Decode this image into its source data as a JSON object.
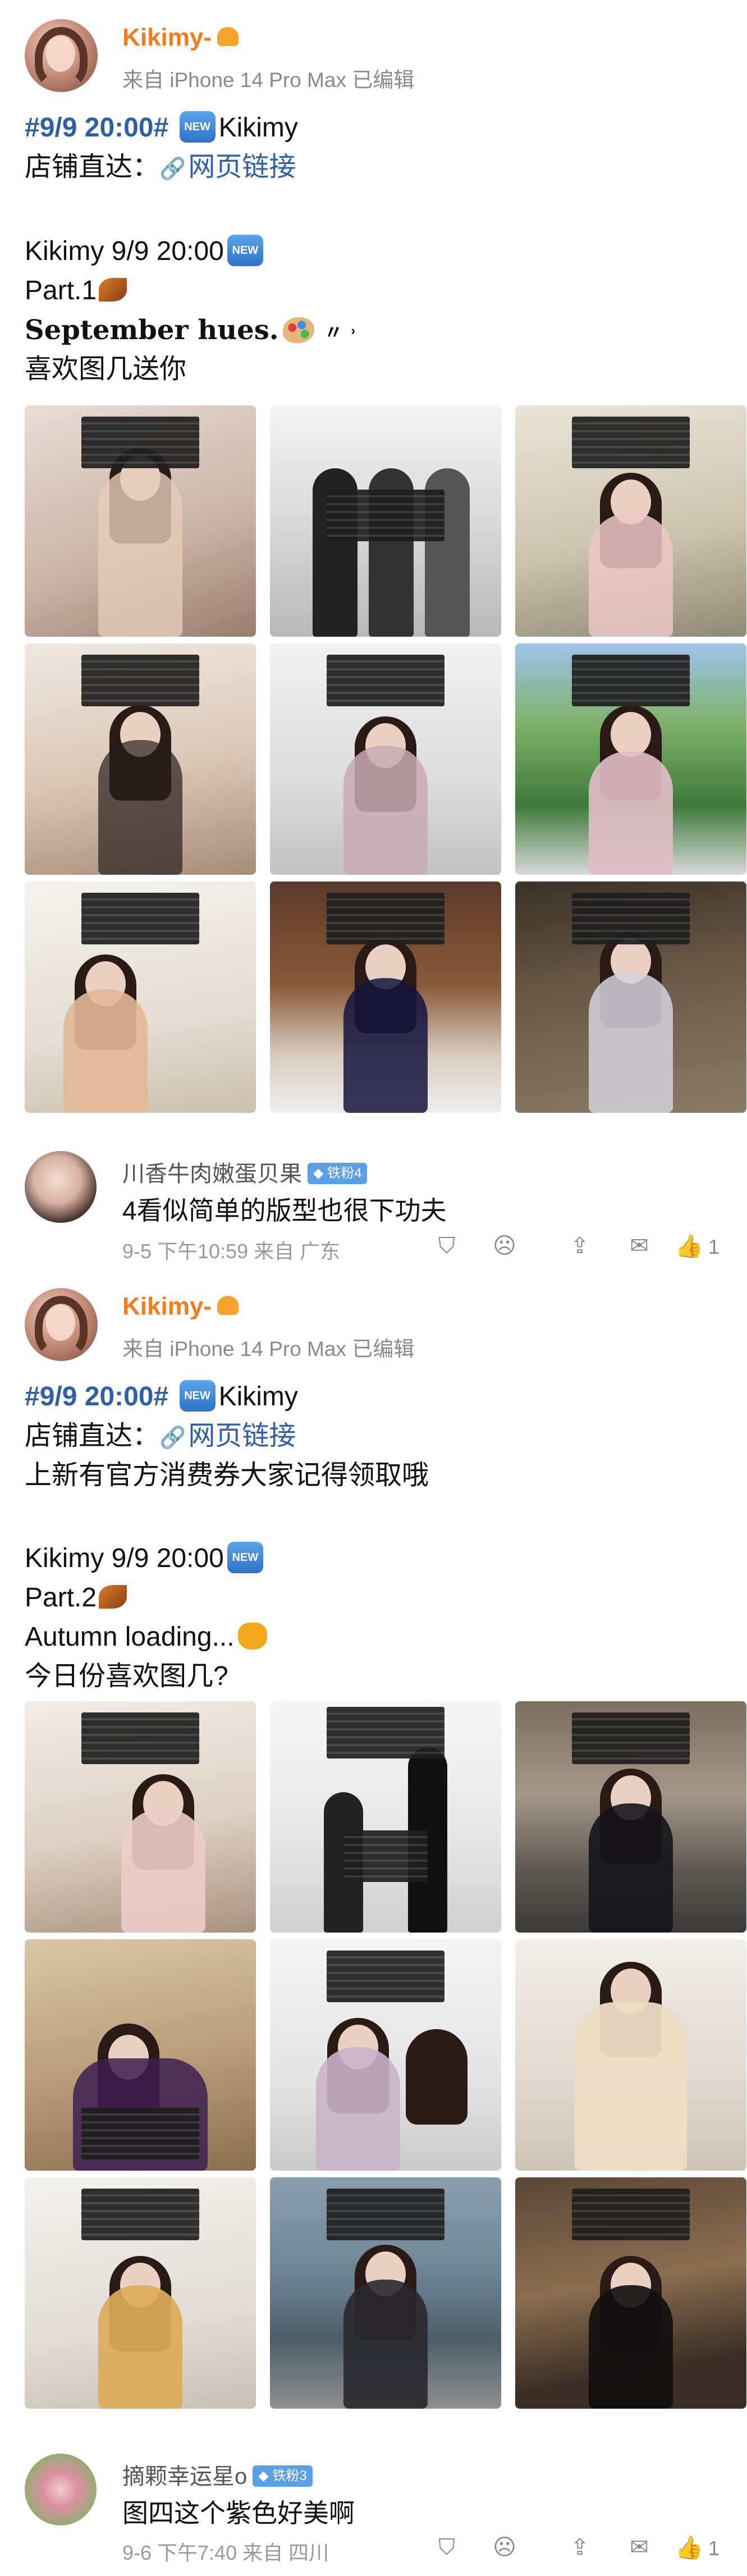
{
  "posts": [
    {
      "author": {
        "name": "Kikimy-",
        "subline": "来自 iPhone 14 Pro Max  已编辑"
      },
      "hashtag": "#9/9 20:00#",
      "hashtag_after": "Kikimy",
      "shop_label": "店铺直达：",
      "shop_link": "网页链接",
      "extra_line": "",
      "title": "Kikimy 9/9 20:00",
      "part": "Part.1",
      "slogan": "September hues.",
      "slogan_suffix": "〃 ˒",
      "question": "喜欢图几送你",
      "comment": {
        "user": "川香牛肉嫩蛋贝果",
        "badge": "铁粉4",
        "text": "4看似简单的版型也很下功夫",
        "time": "9-5 下午10:59  来自 广东",
        "likes": "1"
      }
    },
    {
      "author": {
        "name": "Kikimy-",
        "subline": "来自 iPhone 14 Pro Max  已编辑"
      },
      "hashtag": "#9/9 20:00#",
      "hashtag_after": "Kikimy",
      "shop_label": "店铺直达：",
      "shop_link": "网页链接",
      "extra_line": "上新有官方消费券大家记得领取哦",
      "title": "Kikimy 9/9 20:00",
      "part": "Part.2",
      "slogan": "Autumn loading...",
      "slogan_suffix": "",
      "question": "今日份喜欢图几?",
      "comment": {
        "user": "摘颗幸运星o",
        "badge": "铁粉3",
        "text": "图四这个紫色好美啊",
        "time": "9-6 下午7:40  来自 四川",
        "likes": "1"
      }
    }
  ],
  "badges": {
    "new": "NEW"
  },
  "icons": [
    "crown-icon",
    "new-badge-icon",
    "leaf-icon",
    "palette-icon",
    "honey-icon",
    "link-icon",
    "shield-icon",
    "dislike-icon",
    "share-icon",
    "comment-icon",
    "like-icon"
  ],
  "colors": {
    "username": "#f57b1c",
    "link": "#2f5fa7",
    "meta": "#8a8a8a",
    "fan_badge": "#5ba0e6"
  }
}
